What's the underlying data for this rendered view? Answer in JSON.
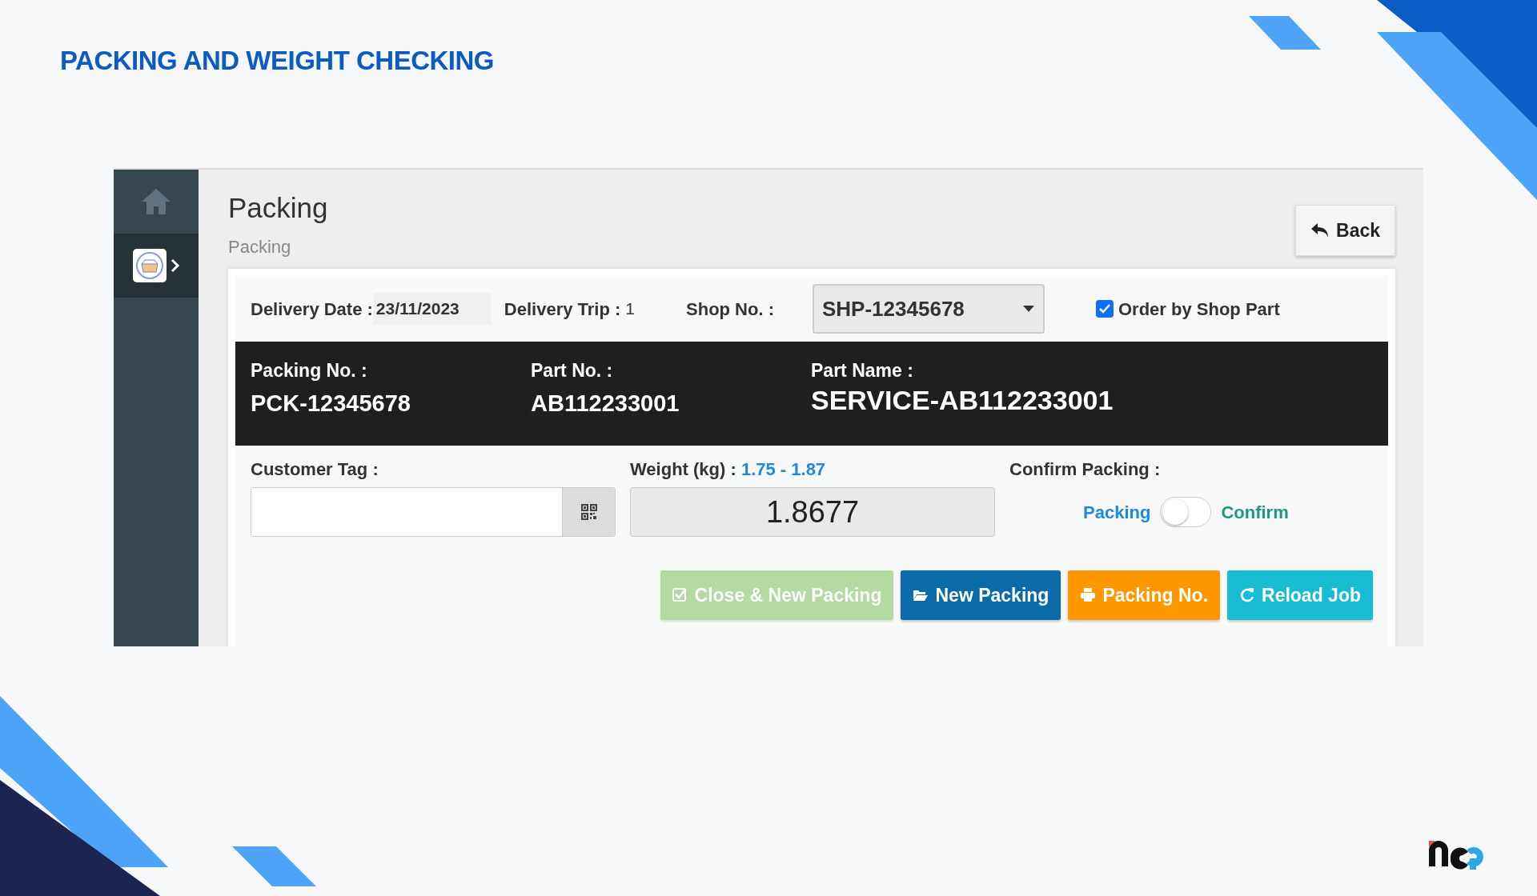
{
  "slide_title": "PACKING AND WEIGHT CHECKING",
  "sidebar": {
    "items": [
      {
        "kind": "home",
        "selected": false
      },
      {
        "kind": "packing",
        "selected": true
      }
    ]
  },
  "header": {
    "title": "Packing",
    "subtitle": "Packing",
    "back_button": "Back"
  },
  "filters": {
    "delivery_date": {
      "label": "Delivery Date :",
      "value": "23/11/2023"
    },
    "delivery_trip": {
      "label": "Delivery Trip :",
      "value": "1"
    },
    "shop_no": {
      "label": "Shop No. :",
      "value": "SHP-12345678"
    },
    "order_by_shop_part": {
      "label": "Order by Shop Part",
      "checked": true
    }
  },
  "info_bar": [
    {
      "label": "Packing No. :",
      "value": "PCK-12345678",
      "kind": "normal"
    },
    {
      "label": "Part No. :",
      "value": "AB112233001",
      "kind": "normal"
    },
    {
      "label": "Part Name :",
      "value": "SERVICE-AB112233001",
      "kind": "large"
    }
  ],
  "customer_tag": {
    "label": "Customer Tag :"
  },
  "weight": {
    "label": "Weight (kg) :",
    "range": "1.75 - 1.87",
    "value": "1.8677"
  },
  "confirm_packing": {
    "label": "Confirm Packing :",
    "off_label": "Packing",
    "on_label": "Confirm",
    "on": false
  },
  "buttons": [
    {
      "label": "Close & New Packing",
      "kind": "close",
      "disabled": true
    },
    {
      "label": "New Packing",
      "kind": "new",
      "disabled": false
    },
    {
      "label": "Packing No.",
      "kind": "print",
      "disabled": false
    },
    {
      "label": "Reload Job",
      "kind": "reload",
      "disabled": false
    }
  ]
}
